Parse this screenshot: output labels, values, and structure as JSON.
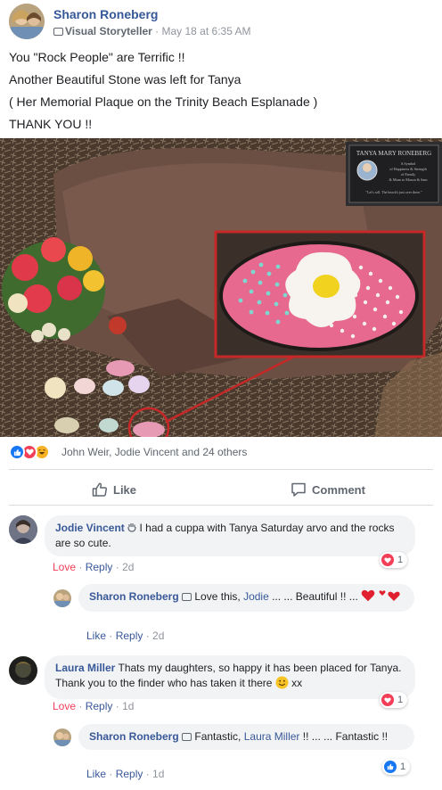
{
  "post": {
    "author": "Sharon Roneberg",
    "badge": "Visual Storyteller",
    "meta_sep": " · ",
    "time": "May 18 at 6:35 AM",
    "lines": [
      "You \"Rock People\" are Terrific !!",
      "Another Beautiful Stone was left for Tanya",
      "( Her Memorial Plaque on the Trinity Beach Esplanade )",
      "THANK YOU !!"
    ]
  },
  "photo": {
    "plaque_title": "TANYA MARY RONEBERG",
    "plaque_lines": [
      "A Symbol",
      "of Happiness & Strength",
      "of Family",
      "& Mum to Mason & Sam",
      "\"Let's roll. The beach's just over there.\""
    ]
  },
  "reactions": {
    "text": "John Weir, Jodie Vincent and 24 others",
    "types": [
      "like",
      "love",
      "haha"
    ]
  },
  "actions": {
    "like": "Like",
    "comment": "Comment"
  },
  "comments": [
    {
      "author": "Jodie Vincent",
      "text": "I had a cuppa with Tanya Saturday arvo and the rocks are so cute.",
      "actions": [
        "Love",
        "Reply",
        "2d"
      ],
      "reaction": {
        "type": "love",
        "count": "1"
      }
    },
    {
      "author": "Sharon Roneberg",
      "text_before": "Love this, ",
      "mention": "Jodie",
      "text_after": " ... ... Beautiful !! ... ",
      "actions": [
        "Like",
        "Reply",
        "2d"
      ]
    },
    {
      "author": "Laura Miller",
      "text": "Thats my daughters, so happy it has been placed for Tanya. Thank you to the finder who has taken it there",
      "text_end": " xx",
      "actions": [
        "Love",
        "Reply",
        "1d"
      ],
      "reaction": {
        "type": "love",
        "count": "1"
      }
    },
    {
      "author": "Sharon Roneberg",
      "text_before": "Fantastic, ",
      "mention": "Laura Miller",
      "text_after": " !! ... ... Fantastic !!",
      "actions": [
        "Like",
        "Reply",
        "1d"
      ],
      "reaction": {
        "type": "like",
        "count": "1"
      }
    }
  ],
  "colors": {
    "link": "#385898",
    "love": "#f33e58",
    "like": "#1877f2",
    "haha": "#f7b125"
  }
}
